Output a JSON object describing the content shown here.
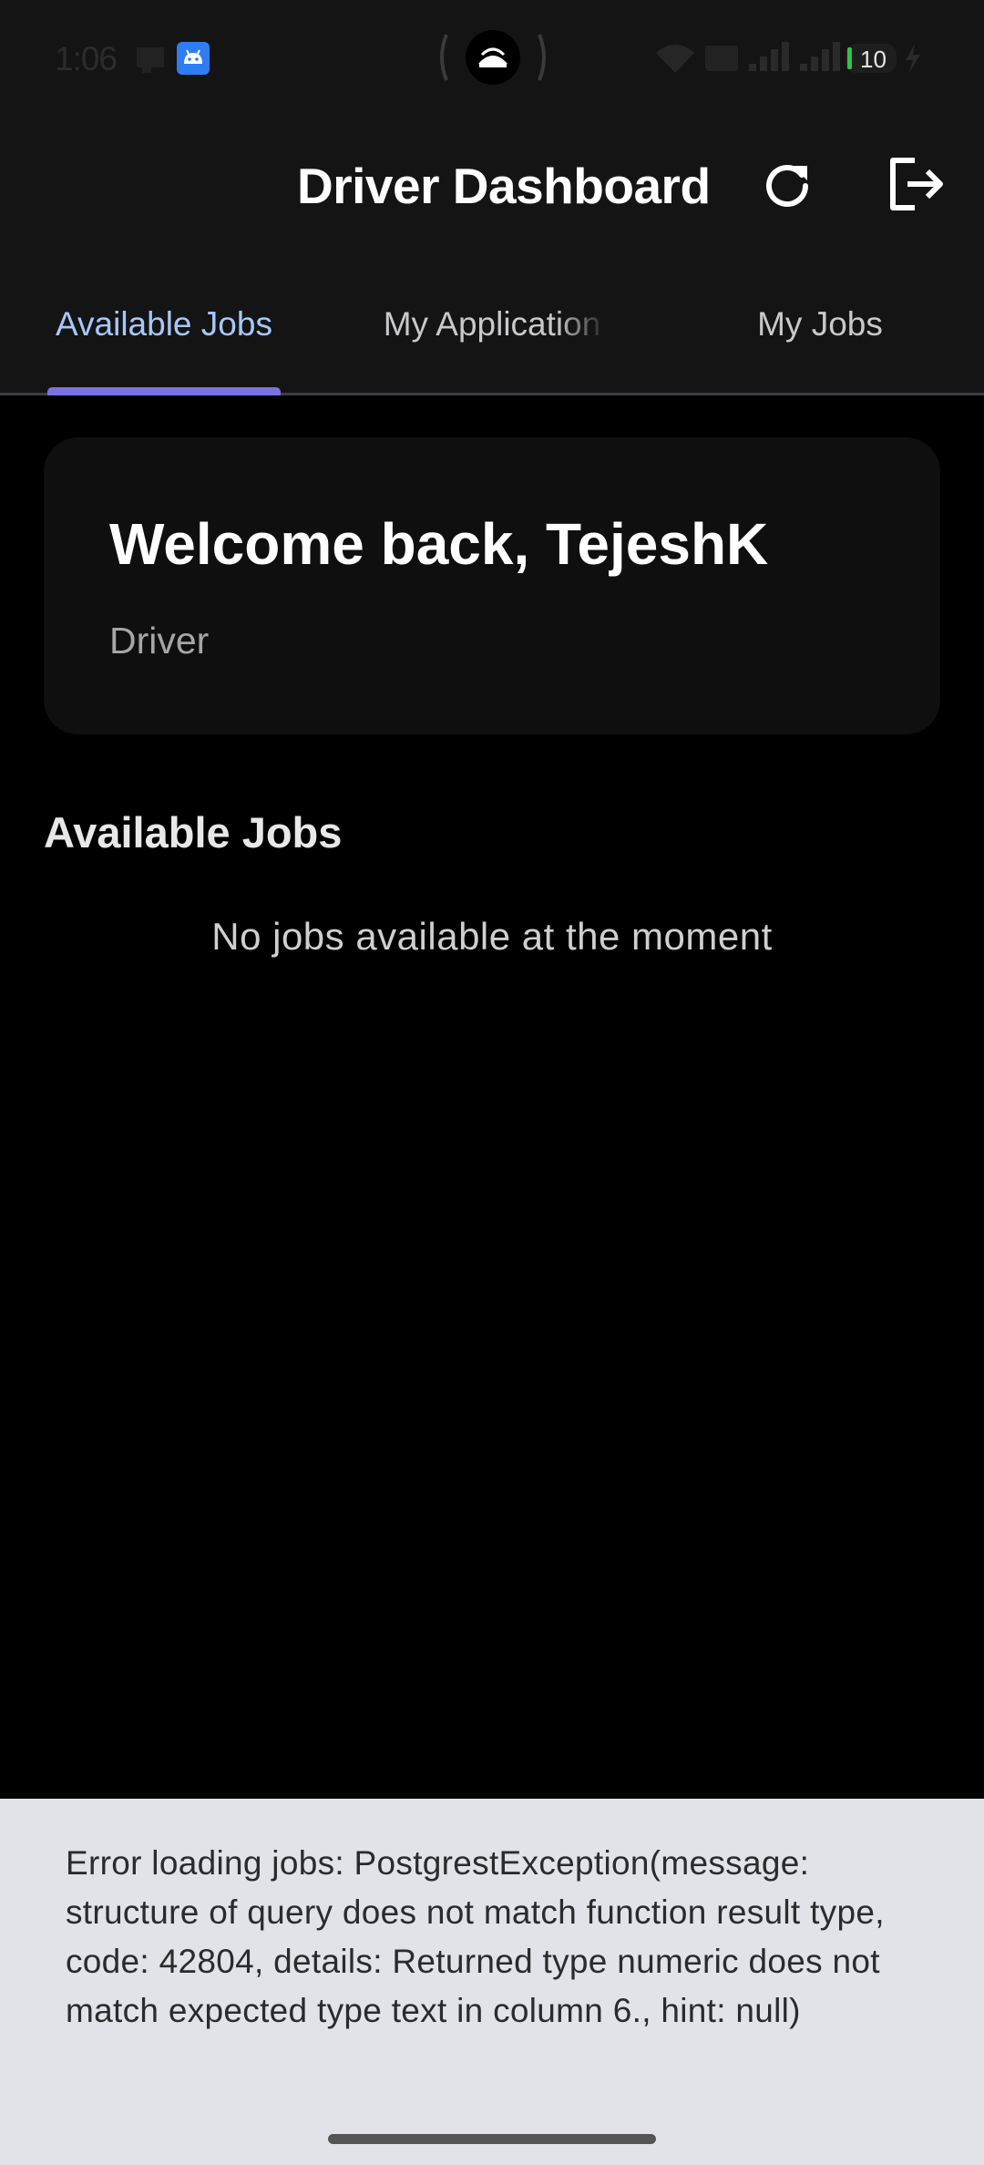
{
  "status_bar": {
    "time": "1:06",
    "battery_level": "10",
    "icons": [
      "cast-icon",
      "android-debug-icon",
      "hotspot-icon",
      "wifi-icon",
      "volte-icon",
      "signal-icon",
      "signal-icon-2",
      "battery-icon",
      "charging-icon"
    ]
  },
  "app_bar": {
    "title": "Driver Dashboard",
    "refresh_icon": "refresh-icon",
    "logout_icon": "logout-icon"
  },
  "tabs": [
    {
      "label": "Available Jobs",
      "active": true
    },
    {
      "label": "My Application",
      "active": false
    },
    {
      "label": "My Jobs",
      "active": false
    }
  ],
  "welcome": {
    "title": "Welcome back, TejeshK",
    "role": "Driver"
  },
  "section": {
    "title": "Available Jobs",
    "empty_message": "No jobs available at the moment"
  },
  "snackbar": {
    "message": "Error loading jobs: PostgrestException(message: structure of query does not match function result type, code: 42804, details: Returned type numeric does not match expected type text in column 6., hint: null)"
  },
  "colors": {
    "background": "#000000",
    "appbar": "#141414",
    "card": "#0f0f0f",
    "tab_active": "#a8c7fa",
    "tab_indicator": "#7b72e0",
    "snackbar": "#e2e3e8"
  }
}
